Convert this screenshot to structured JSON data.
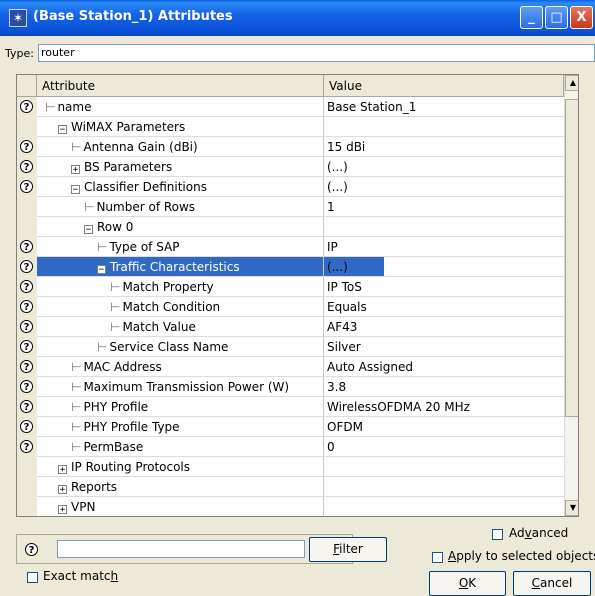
{
  "window": {
    "title": "(Base Station_1) Attributes",
    "minimize": "_",
    "maximize": "□",
    "close": "X"
  },
  "type_field": {
    "label": "Type:",
    "value": "router"
  },
  "grid": {
    "headers": {
      "attribute": "Attribute",
      "value": "Value"
    },
    "rows": [
      {
        "help": true,
        "indent": 0,
        "expander": "",
        "tick": true,
        "attribute": "name",
        "value": "Base Station_1"
      },
      {
        "help": false,
        "indent": 1,
        "expander": "−",
        "tick": false,
        "attribute": "WiMAX Parameters",
        "value": ""
      },
      {
        "help": true,
        "indent": 2,
        "expander": "",
        "tick": true,
        "attribute": "Antenna Gain (dBi)",
        "value": "15 dBi"
      },
      {
        "help": true,
        "indent": 2,
        "expander": "+",
        "tick": false,
        "attribute": "BS Parameters",
        "value": "(...)"
      },
      {
        "help": true,
        "indent": 2,
        "expander": "−",
        "tick": false,
        "attribute": "Classifier Definitions",
        "value": "(...)"
      },
      {
        "help": false,
        "indent": 3,
        "expander": "",
        "tick": true,
        "attribute": "Number of Rows",
        "value": "1"
      },
      {
        "help": false,
        "indent": 3,
        "expander": "−",
        "tick": false,
        "attribute": "Row 0",
        "value": ""
      },
      {
        "help": true,
        "indent": 4,
        "expander": "",
        "tick": true,
        "attribute": "Type of SAP",
        "value": "IP"
      },
      {
        "help": true,
        "indent": 4,
        "expander": "−",
        "tick": false,
        "attribute": "Traffic Characteristics",
        "value": "(...)",
        "selected": true
      },
      {
        "help": true,
        "indent": 5,
        "expander": "",
        "tick": true,
        "attribute": "Match Property",
        "value": "IP ToS"
      },
      {
        "help": true,
        "indent": 5,
        "expander": "",
        "tick": true,
        "attribute": "Match Condition",
        "value": "Equals"
      },
      {
        "help": true,
        "indent": 5,
        "expander": "",
        "tick": true,
        "attribute": "Match Value",
        "value": "AF43"
      },
      {
        "help": true,
        "indent": 4,
        "expander": "",
        "tick": true,
        "attribute": "Service Class Name",
        "value": "Silver"
      },
      {
        "help": true,
        "indent": 2,
        "expander": "",
        "tick": true,
        "attribute": "MAC Address",
        "value": "Auto Assigned"
      },
      {
        "help": true,
        "indent": 2,
        "expander": "",
        "tick": true,
        "attribute": "Maximum Transmission Power (W)",
        "value": "3.8"
      },
      {
        "help": true,
        "indent": 2,
        "expander": "",
        "tick": true,
        "attribute": "PHY Profile",
        "value": "WirelessOFDMA 20 MHz"
      },
      {
        "help": true,
        "indent": 2,
        "expander": "",
        "tick": true,
        "attribute": "PHY Profile Type",
        "value": "OFDM"
      },
      {
        "help": true,
        "indent": 2,
        "expander": "",
        "tick": true,
        "attribute": "PermBase",
        "value": "0"
      },
      {
        "help": false,
        "indent": 1,
        "expander": "+",
        "tick": false,
        "attribute": "IP Routing Protocols",
        "value": ""
      },
      {
        "help": false,
        "indent": 1,
        "expander": "+",
        "tick": false,
        "attribute": "Reports",
        "value": ""
      },
      {
        "help": false,
        "indent": 1,
        "expander": "+",
        "tick": false,
        "attribute": "VPN",
        "value": ""
      }
    ]
  },
  "bottom": {
    "help_symbol": "?",
    "search_value": "",
    "filter_button": {
      "pre": "",
      "u": "F",
      "post": "ilter"
    },
    "exact_match": {
      "pre": "Exact matc",
      "u": "h",
      "post": ""
    },
    "advanced": {
      "pre": "Ad",
      "u": "v",
      "post": "anced"
    },
    "apply_selected": {
      "pre": "",
      "u": "A",
      "post": "pply to selected objects"
    },
    "ok_button": {
      "pre": "",
      "u": "O",
      "post": "K"
    },
    "cancel_button": {
      "pre": "",
      "u": "C",
      "post": "ancel"
    }
  },
  "colors": {
    "title_bar": "#0b52d9",
    "selection": "#316ac5",
    "dialog_bg": "#ece9d8"
  }
}
